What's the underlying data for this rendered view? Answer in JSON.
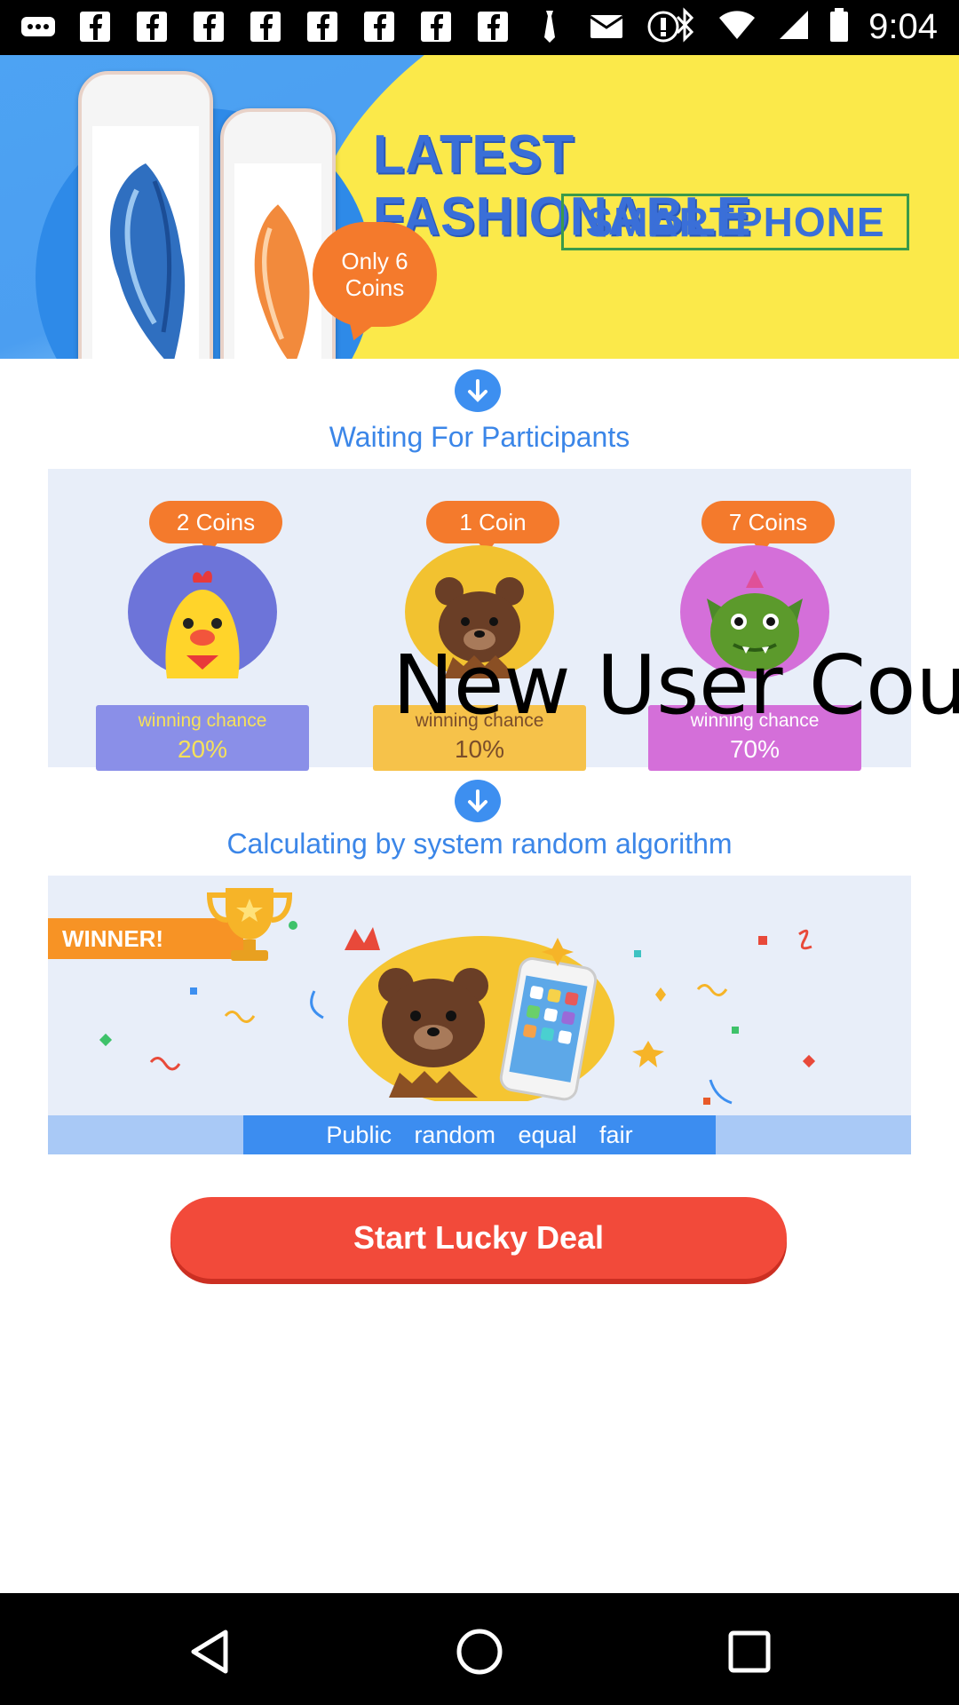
{
  "status_bar": {
    "time": "9:04",
    "left_icons": [
      "more-icon",
      "fb-icon",
      "fb-icon",
      "fb-icon",
      "fb-icon",
      "fb-icon",
      "fb-icon",
      "fb-icon",
      "fb-icon",
      "fb-icon",
      "info-icon",
      "mail-icon",
      "alert-icon"
    ],
    "right_icons": [
      "bluetooth-icon",
      "wifi-icon",
      "signal-icon",
      "battery-icon"
    ]
  },
  "banner": {
    "title": "LATEST FASHIONABLE",
    "subtitle": "SMARTPHONE",
    "bubble_line1": "Only 6",
    "bubble_line2": "Coins"
  },
  "participants": {
    "title": "Waiting For Participants",
    "items": [
      {
        "coins": "2 Coins",
        "chance_label": "winning chance",
        "chance_value": "20%",
        "color": "#8a8fe8",
        "avatar": "chick-icon"
      },
      {
        "coins": "1 Coin",
        "chance_label": "winning chance",
        "chance_value": "10%",
        "color": "#f6c24a",
        "avatar": "bear-icon"
      },
      {
        "coins": "7 Coins",
        "chance_label": "winning chance",
        "chance_value": "70%",
        "color": "#d46fd9",
        "avatar": "dragon-icon"
      }
    ]
  },
  "calculation": {
    "title": "Calculating by system random algorithm"
  },
  "winner": {
    "tag": "WINNER!",
    "footer": "Public random equal fair"
  },
  "cta_label": "Start Lucky Deal",
  "overlay_text": "New User Cou",
  "colors": {
    "accent_blue": "#3b86e8",
    "accent_orange": "#f47a2c",
    "cta_red": "#f24a3a"
  }
}
